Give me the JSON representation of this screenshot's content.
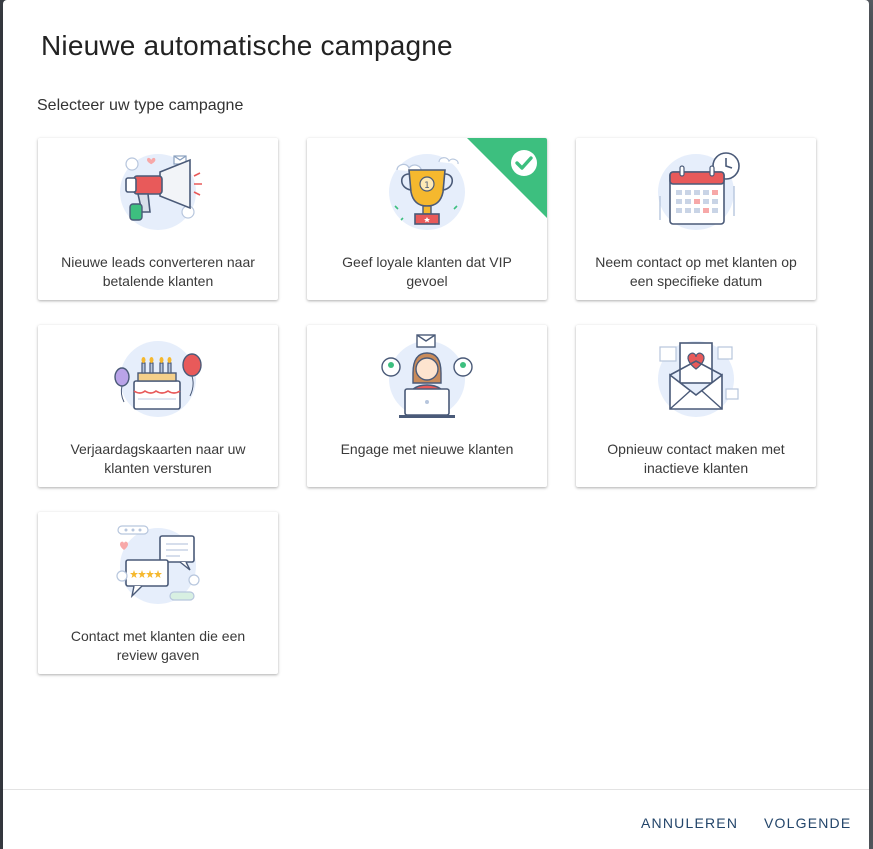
{
  "dialog": {
    "title": "Nieuwe automatische campagne",
    "subtitle": "Selecteer uw type campagne"
  },
  "campaigns": [
    {
      "label": "Nieuwe leads converteren naar betalende klanten",
      "icon": "megaphone-illustration",
      "selected": false
    },
    {
      "label": "Geef loyale klanten dat VIP gevoel",
      "icon": "trophy-illustration",
      "selected": true
    },
    {
      "label": "Neem contact op met klanten op een specifieke datum",
      "icon": "calendar-illustration",
      "selected": false
    },
    {
      "label": "Verjaardagskaarten naar uw klanten versturen",
      "icon": "birthday-cake-illustration",
      "selected": false
    },
    {
      "label": "Engage met nieuwe klanten",
      "icon": "laptop-person-illustration",
      "selected": false
    },
    {
      "label": "Opnieuw contact maken met inactieve klanten",
      "icon": "envelope-heart-illustration",
      "selected": false
    },
    {
      "label": "Contact met klanten die een review gaven",
      "icon": "review-chat-illustration",
      "selected": false
    }
  ],
  "footer": {
    "cancel_label": "ANNULEREN",
    "next_label": "VOLGENDE"
  },
  "colors": {
    "selected_badge": "#3dbf7f",
    "button_text": "#23456a",
    "accent_red": "#e85a5a",
    "accent_yellow": "#f5b82e"
  }
}
